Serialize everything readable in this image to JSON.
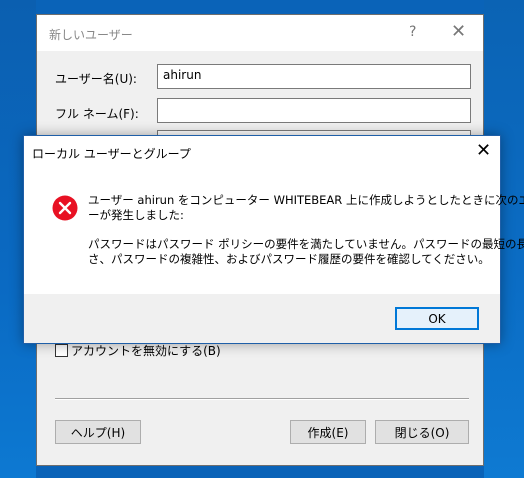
{
  "background_dialog": {
    "title": "新しいユーザー",
    "help_glyph": "?",
    "close_glyph": "✕",
    "username_label": "ユーザー名(U):",
    "username_value": "ahirun",
    "fullname_label": "フル ネーム(F):",
    "fullname_value": "",
    "disable_account_label": "アカウントを無効にする(B)",
    "help_button": "ヘルプ(H)",
    "create_button": "作成(E)",
    "close_button": "閉じる(O)"
  },
  "error_dialog": {
    "title": "ローカル ユーザーとグループ",
    "close_glyph": "✕",
    "icon": "error-icon",
    "message_line1": "ユーザー ahirun をコンピューター WHITEBEAR 上に作成しようとしたときに次のエラ",
    "message_line2": "ーが発生しました:",
    "message_line3": "パスワードはパスワード ポリシーの要件を満たしていません。パスワードの最短の長",
    "message_line4": "さ、パスワードの複雑性、およびパスワード履歴の要件を確認してください。",
    "ok_button": "OK"
  },
  "colors": {
    "desktop": "#0a63b8",
    "dialog_border": "#1f5fa8",
    "error_red": "#e81123",
    "focus_blue": "#0078d7"
  }
}
